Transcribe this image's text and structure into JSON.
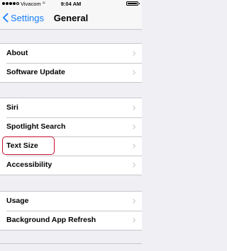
{
  "status_bar": {
    "carrier": "Vivacom",
    "time": "9:04 AM",
    "signal_bars": 4,
    "signal_total": 5
  },
  "nav": {
    "back_label": "Settings",
    "title": "General"
  },
  "groups": [
    [
      {
        "label": "About"
      },
      {
        "label": "Software Update"
      }
    ],
    [
      {
        "label": "Siri"
      },
      {
        "label": "Spotlight Search"
      },
      {
        "label": "Text Size"
      },
      {
        "label": "Accessibility"
      }
    ],
    [
      {
        "label": "Usage"
      },
      {
        "label": "Background App Refresh"
      }
    ]
  ],
  "colors": {
    "accent": "#157efb",
    "highlight": "#c4112f",
    "background": "#efeff4"
  }
}
